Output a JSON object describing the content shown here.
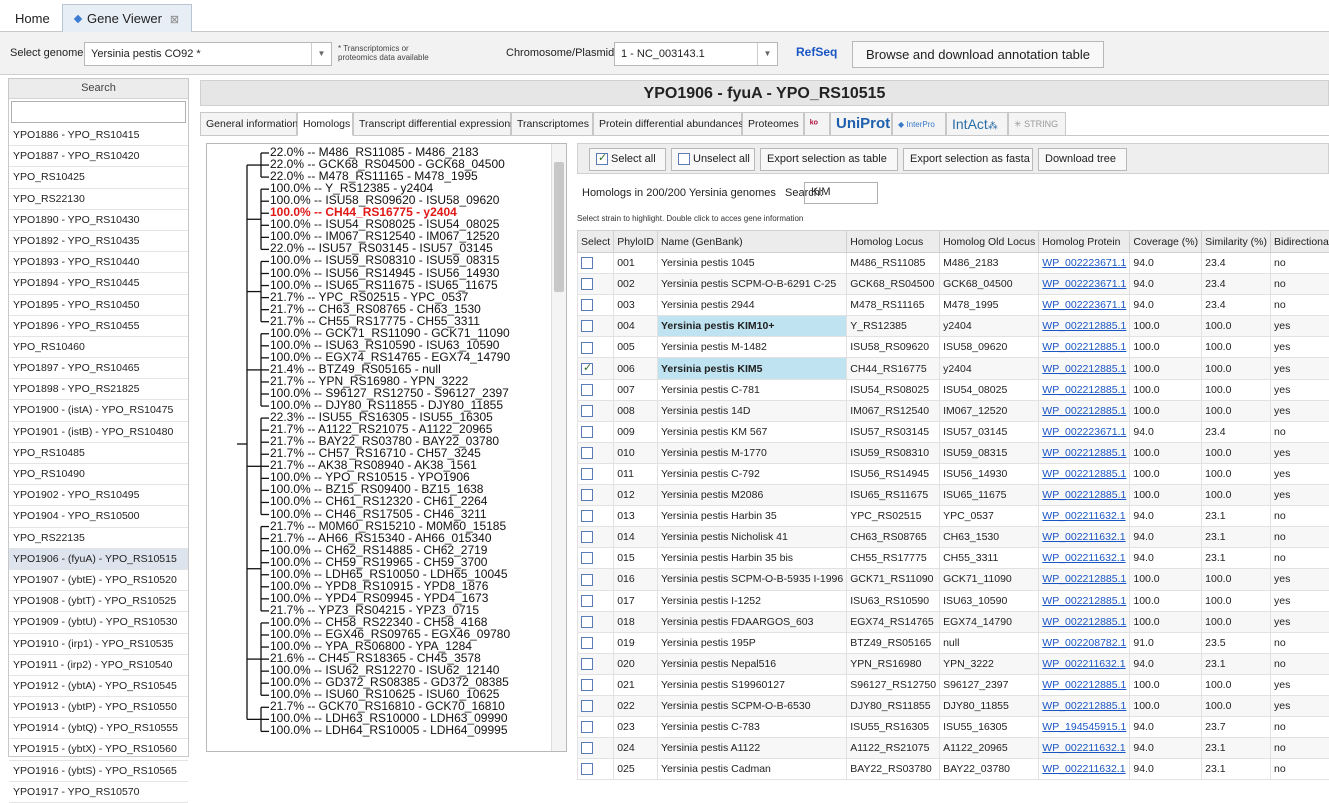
{
  "top_tabs": [
    {
      "label": "Home"
    },
    {
      "label": "Gene Viewer",
      "close": "⊠"
    }
  ],
  "controls": {
    "genome_label": "Select genome",
    "genome_value": "Yersinia pestis CO92 *",
    "genome_note_line1": "* Transcriptomics or",
    "genome_note_line2": "proteomics data available",
    "chrom_label": "Chromosome/Plasmids",
    "chrom_value": "1 - NC_003143.1",
    "refseq": "RefSeq",
    "browse_button": "Browse and download annotation table"
  },
  "sidebar": {
    "search_label": "Search",
    "items": [
      "YPO1886 - YPO_RS10415",
      "YPO1887 - YPO_RS10420",
      "YPO_RS10425",
      "YPO_RS22130",
      "YPO1890 - YPO_RS10430",
      "YPO1892 - YPO_RS10435",
      "YPO1893 - YPO_RS10440",
      "YPO1894 - YPO_RS10445",
      "YPO1895 - YPO_RS10450",
      "YPO1896 - YPO_RS10455",
      "YPO_RS10460",
      "YPO1897 - YPO_RS10465",
      "YPO1898 - YPO_RS21825",
      "YPO1900 - (istA) - YPO_RS10475",
      "YPO1901 - (istB) - YPO_RS10480",
      "YPO_RS10485",
      "YPO_RS10490",
      "YPO1902 - YPO_RS10495",
      "YPO1904 - YPO_RS10500",
      "YPO_RS22135",
      "YPO1906 - (fyuA) - YPO_RS10515",
      "YPO1907 - (ybtE) - YPO_RS10520",
      "YPO1908 - (ybtT) - YPO_RS10525",
      "YPO1909 - (ybtU) - YPO_RS10530",
      "YPO1910 - (irp1) - YPO_RS10535",
      "YPO1911 - (irp2) - YPO_RS10540",
      "YPO1912 - (ybtA) - YPO_RS10545",
      "YPO1913 - (ybtP) - YPO_RS10550",
      "YPO1914 - (ybtQ) - YPO_RS10555",
      "YPO1915 - (ybtX) - YPO_RS10560",
      "YPO1916 - (ybtS) - YPO_RS10565",
      "YPO1917 - YPO_RS10570"
    ],
    "selected_index": 20
  },
  "gene_title": "YPO1906 - fyuA - YPO_RS10515",
  "detail_tabs": {
    "general": "General information",
    "homologs": "Homologs",
    "transcript_diff": "Transcript differential expressions",
    "transcriptomes": "Transcriptomes",
    "protein_diff": "Protein differential abundances",
    "proteomes": "Proteomes",
    "uniprot": "UniProt",
    "interpro": "InterPro",
    "intact": "IntAct",
    "string": "STRING"
  },
  "tree": {
    "lines": [
      "22.0% -- M486_RS11085 - M486_2183",
      "22.0% -- GCK68_RS04500 - GCK68_04500",
      "22.0% -- M478_RS11165 - M478_1995",
      "100.0% -- Y_RS12385 - y2404",
      "100.0% -- ISU58_RS09620 - ISU58_09620",
      "100.0% -- CH44_RS16775 - y2404",
      "100.0% -- ISU54_RS08025 - ISU54_08025",
      "100.0% -- IM067_RS12540 - IM067_12520",
      "22.0% -- ISU57_RS03145 - ISU57_03145",
      "100.0% -- ISU59_RS08310 - ISU59_08315",
      "100.0% -- ISU56_RS14945 - ISU56_14930",
      "100.0% -- ISU65_RS11675 - ISU65_11675",
      "21.7% -- YPC_RS02515 - YPC_0537",
      "21.7% -- CH63_RS08765 - CH63_1530",
      "21.7% -- CH55_RS17775 - CH55_3311",
      "100.0% -- GCK71_RS11090 - GCK71_11090",
      "100.0% -- ISU63_RS10590 - ISU63_10590",
      "100.0% -- EGX74_RS14765 - EGX74_14790",
      "21.4% -- BTZ49_RS05165 - null",
      "21.7% -- YPN_RS16980 - YPN_3222",
      "100.0% -- S96127_RS12750 - S96127_2397",
      "100.0% -- DJY80_RS11855 - DJY80_11855",
      "22.3% -- ISU55_RS16305 - ISU55_16305",
      "21.7% -- A1122_RS21075 - A1122_20965",
      "21.7% -- BAY22_RS03780 - BAY22_03780",
      "21.7% -- CH57_RS16710 - CH57_3245",
      "21.7% -- AK38_RS08940 - AK38_1561",
      "100.0% -- YPO_RS10515 - YPO1906",
      "100.0% -- BZ15_RS09400 - BZ15_1638",
      "100.0% -- CH61_RS12320 - CH61_2264",
      "100.0% -- CH46_RS17505 - CH46_3211",
      "21.7% -- M0M60_RS15210 - M0M60_15185",
      "21.7% -- AH66_RS15340 - AH66_015340",
      "100.0% -- CH62_RS14885 - CH62_2719",
      "100.0% -- CH59_RS19965 - CH59_3700",
      "100.0% -- LDH65_RS10050 - LDH65_10045",
      "100.0% -- YPD8_RS10915 - YPD8_1876",
      "100.0% -- YPD4_RS09945 - YPD4_1673",
      "21.7% -- YPZ3_RS04215 - YPZ3_0715",
      "100.0% -- CH58_RS22340 - CH58_4168",
      "100.0% -- EGX46_RS09765 - EGX46_09780",
      "100.0% -- YPA_RS06800 - YPA_1284",
      "21.6% -- CH45_RS18365 - CH45_3578",
      "100.0% -- ISU62_RS12270 - ISU62_12140",
      "100.0% -- GD372_RS08385 - GD372_08385",
      "100.0% -- ISU60_RS10625 - ISU60_10625",
      "21.7% -- GCK70_RS16810 - GCK70_16810",
      "100.0% -- LDH63_RS10000 - LDH63_09990",
      "100.0% -- LDH64_RS10005 - LDH64_09995"
    ],
    "highlight_index": 5
  },
  "homologs": {
    "select_all": "Select all",
    "unselect_all": "Unselect all",
    "export_table": "Export selection as table",
    "export_fasta": "Export selection as fasta",
    "download_tree": "Download tree",
    "count_text": "Homologs in 200/200 Yersinia genomes",
    "search_label": "Search:",
    "search_value": "KIM",
    "hint": "Select strain to highlight. Double click to acces gene information",
    "columns": [
      "Select",
      "PhyloID",
      "Name (GenBank)",
      "Homolog Locus",
      "Homolog Old Locus",
      "Homolog Protein",
      "Coverage (%)",
      "Similarity (%)",
      "Bidirectional"
    ],
    "rows": [
      {
        "checked": false,
        "hl": false,
        "cells": [
          "001",
          "Yersinia pestis 1045",
          "M486_RS11085",
          "M486_2183",
          "WP_002223671.1",
          "94.0",
          "23.4",
          "no"
        ]
      },
      {
        "checked": false,
        "hl": false,
        "cells": [
          "002",
          "Yersinia pestis SCPM-O-B-6291 C-25",
          "GCK68_RS04500",
          "GCK68_04500",
          "WP_002223671.1",
          "94.0",
          "23.4",
          "no"
        ]
      },
      {
        "checked": false,
        "hl": false,
        "cells": [
          "003",
          "Yersinia pestis 2944",
          "M478_RS11165",
          "M478_1995",
          "WP_002223671.1",
          "94.0",
          "23.4",
          "no"
        ]
      },
      {
        "checked": false,
        "hl": true,
        "cells": [
          "004",
          "Yersinia pestis KIM10+",
          "Y_RS12385",
          "y2404",
          "WP_002212885.1",
          "100.0",
          "100.0",
          "yes"
        ]
      },
      {
        "checked": false,
        "hl": false,
        "cells": [
          "005",
          "Yersinia pestis M-1482",
          "ISU58_RS09620",
          "ISU58_09620",
          "WP_002212885.1",
          "100.0",
          "100.0",
          "yes"
        ]
      },
      {
        "checked": true,
        "hl": true,
        "cells": [
          "006",
          "Yersinia pestis KIM5",
          "CH44_RS16775",
          "y2404",
          "WP_002212885.1",
          "100.0",
          "100.0",
          "yes"
        ]
      },
      {
        "checked": false,
        "hl": false,
        "cells": [
          "007",
          "Yersinia pestis C-781",
          "ISU54_RS08025",
          "ISU54_08025",
          "WP_002212885.1",
          "100.0",
          "100.0",
          "yes"
        ]
      },
      {
        "checked": false,
        "hl": false,
        "cells": [
          "008",
          "Yersinia pestis 14D",
          "IM067_RS12540",
          "IM067_12520",
          "WP_002212885.1",
          "100.0",
          "100.0",
          "yes"
        ]
      },
      {
        "checked": false,
        "hl": false,
        "cells": [
          "009",
          "Yersinia pestis KM 567",
          "ISU57_RS03145",
          "ISU57_03145",
          "WP_002223671.1",
          "94.0",
          "23.4",
          "no"
        ]
      },
      {
        "checked": false,
        "hl": false,
        "cells": [
          "010",
          "Yersinia pestis M-1770",
          "ISU59_RS08310",
          "ISU59_08315",
          "WP_002212885.1",
          "100.0",
          "100.0",
          "yes"
        ]
      },
      {
        "checked": false,
        "hl": false,
        "cells": [
          "011",
          "Yersinia pestis C-792",
          "ISU56_RS14945",
          "ISU56_14930",
          "WP_002212885.1",
          "100.0",
          "100.0",
          "yes"
        ]
      },
      {
        "checked": false,
        "hl": false,
        "cells": [
          "012",
          "Yersinia pestis M2086",
          "ISU65_RS11675",
          "ISU65_11675",
          "WP_002212885.1",
          "100.0",
          "100.0",
          "yes"
        ]
      },
      {
        "checked": false,
        "hl": false,
        "cells": [
          "013",
          "Yersinia pestis Harbin 35",
          "YPC_RS02515",
          "YPC_0537",
          "WP_002211632.1",
          "94.0",
          "23.1",
          "no"
        ]
      },
      {
        "checked": false,
        "hl": false,
        "cells": [
          "014",
          "Yersinia pestis Nicholisk 41",
          "CH63_RS08765",
          "CH63_1530",
          "WP_002211632.1",
          "94.0",
          "23.1",
          "no"
        ]
      },
      {
        "checked": false,
        "hl": false,
        "cells": [
          "015",
          "Yersinia pestis Harbin 35 bis",
          "CH55_RS17775",
          "CH55_3311",
          "WP_002211632.1",
          "94.0",
          "23.1",
          "no"
        ]
      },
      {
        "checked": false,
        "hl": false,
        "cells": [
          "016",
          "Yersinia pestis SCPM-O-B-5935 I-1996",
          "GCK71_RS11090",
          "GCK71_11090",
          "WP_002212885.1",
          "100.0",
          "100.0",
          "yes"
        ]
      },
      {
        "checked": false,
        "hl": false,
        "cells": [
          "017",
          "Yersinia pestis I-1252",
          "ISU63_RS10590",
          "ISU63_10590",
          "WP_002212885.1",
          "100.0",
          "100.0",
          "yes"
        ]
      },
      {
        "checked": false,
        "hl": false,
        "cells": [
          "018",
          "Yersinia pestis FDAARGOS_603",
          "EGX74_RS14765",
          "EGX74_14790",
          "WP_002212885.1",
          "100.0",
          "100.0",
          "yes"
        ]
      },
      {
        "checked": false,
        "hl": false,
        "cells": [
          "019",
          "Yersinia pestis 195P",
          "BTZ49_RS05165",
          "null",
          "WP_002208782.1",
          "91.0",
          "23.5",
          "no"
        ]
      },
      {
        "checked": false,
        "hl": false,
        "cells": [
          "020",
          "Yersinia pestis Nepal516",
          "YPN_RS16980",
          "YPN_3222",
          "WP_002211632.1",
          "94.0",
          "23.1",
          "no"
        ]
      },
      {
        "checked": false,
        "hl": false,
        "cells": [
          "021",
          "Yersinia pestis S19960127",
          "S96127_RS12750",
          "S96127_2397",
          "WP_002212885.1",
          "100.0",
          "100.0",
          "yes"
        ]
      },
      {
        "checked": false,
        "hl": false,
        "cells": [
          "022",
          "Yersinia pestis SCPM-O-B-6530",
          "DJY80_RS11855",
          "DJY80_11855",
          "WP_002212885.1",
          "100.0",
          "100.0",
          "yes"
        ]
      },
      {
        "checked": false,
        "hl": false,
        "cells": [
          "023",
          "Yersinia pestis C-783",
          "ISU55_RS16305",
          "ISU55_16305",
          "WP_194545915.1",
          "94.0",
          "23.7",
          "no"
        ]
      },
      {
        "checked": false,
        "hl": false,
        "cells": [
          "024",
          "Yersinia pestis A1122",
          "A1122_RS21075",
          "A1122_20965",
          "WP_002211632.1",
          "94.0",
          "23.1",
          "no"
        ]
      },
      {
        "checked": false,
        "hl": false,
        "cells": [
          "025",
          "Yersinia pestis Cadman",
          "BAY22_RS03780",
          "BAY22_03780",
          "WP_002211632.1",
          "94.0",
          "23.1",
          "no"
        ]
      }
    ]
  },
  "colors": {
    "accent": "#1a55c4",
    "highlight_row": "#bfe3f0",
    "tree_highlight": "#e01818"
  }
}
